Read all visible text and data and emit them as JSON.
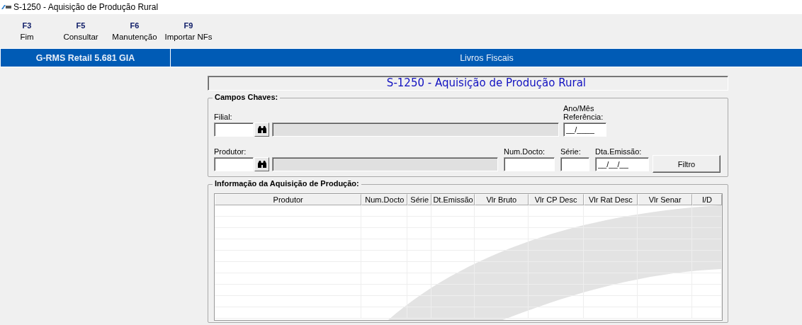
{
  "window": {
    "title": "S-1250 - Aquisição de Produção Rural"
  },
  "toolbar": [
    {
      "key": "F3",
      "label": "Fim"
    },
    {
      "key": "F5",
      "label": "Consultar"
    },
    {
      "key": "F6",
      "label": "Manutenção"
    },
    {
      "key": "F9",
      "label": "Importar NFs"
    }
  ],
  "header_bar": {
    "left": "G-RMS Retail 5.681 GIA",
    "right": "Livros Fiscais"
  },
  "form_title": "S-1250 - Aquisição de Produção Rural",
  "key_fields": {
    "title": "Campos Chaves:",
    "filial": {
      "label": "Filial:"
    },
    "ano_mes": {
      "label": "Ano/Mês Referência:",
      "value": "__/____"
    },
    "produtor": {
      "label": "Produtor:"
    },
    "num_docto": {
      "label": "Num.Docto:"
    },
    "serie": {
      "label": "Série:"
    },
    "dta_emissao": {
      "label": "Dta.Emissão:",
      "value": "__/__/__"
    },
    "filter_button": "Filtro"
  },
  "grid": {
    "title": "Informação da Aquisição de Produção:",
    "columns": [
      "Produtor",
      "Num.Docto",
      "Série",
      "Dt.Emissão",
      "Vlr Bruto",
      "Vlr CP Desc",
      "Vlr Rat Desc",
      "Vlr Senar",
      "I/D"
    ]
  }
}
